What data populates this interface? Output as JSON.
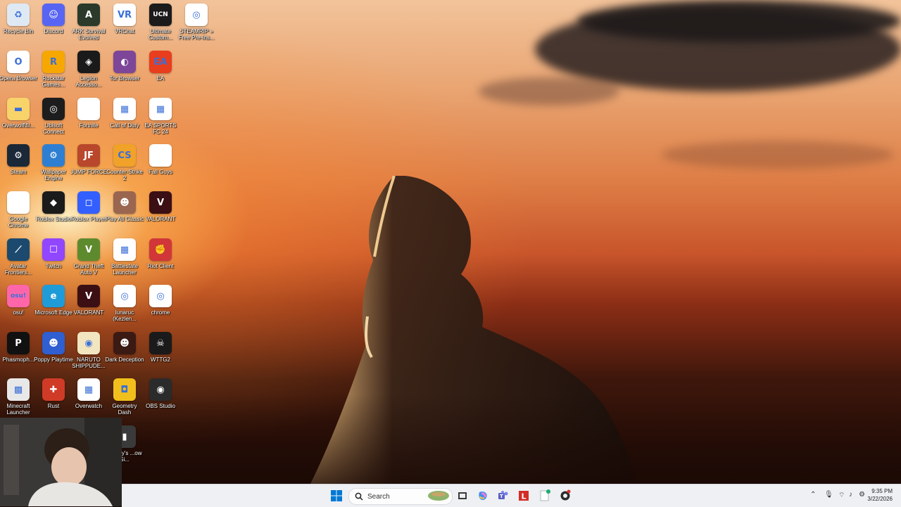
{
  "desktop": {
    "icons": [
      {
        "label": "Recycle Bin",
        "icon": "recycle-bin-icon",
        "color": "#dfe9f3",
        "glyph": "♻"
      },
      {
        "label": "Discord",
        "icon": "discord-icon",
        "color": "#5865f2",
        "glyph": "☺"
      },
      {
        "label": "ARK Survival Evolved",
        "icon": "ark-icon",
        "color": "#2b3a2a",
        "glyph": "A"
      },
      {
        "label": "VRChat",
        "icon": "vrchat-icon",
        "color": "#ffffff",
        "glyph": "VR"
      },
      {
        "label": "Ultimate Custom...",
        "icon": "ucn-icon",
        "color": "#1b1b1b",
        "glyph": "UCN"
      },
      {
        "label": "STEAMRIP » Free Pre-Ins...",
        "icon": "chrome-shortcut-icon",
        "color": "#ffffff",
        "glyph": "◎"
      },
      {
        "label": "Opera Browser",
        "icon": "opera-icon",
        "color": "#ffffff",
        "glyph": "O"
      },
      {
        "label": "Rockstar Games...",
        "icon": "rockstar-icon",
        "color": "#f6a800",
        "glyph": "R"
      },
      {
        "label": "Legion Accesso...",
        "icon": "legion-icon",
        "color": "#1a1a1a",
        "glyph": "◈"
      },
      {
        "label": "Tor Browser",
        "icon": "tor-icon",
        "color": "#7d4698",
        "glyph": "◐"
      },
      {
        "label": "EA",
        "icon": "ea-icon",
        "color": "#e83e1e",
        "glyph": "EA"
      },
      {
        "label": "Overwolf\\fil...",
        "icon": "folder-icon",
        "color": "#f7d36a",
        "glyph": "▬"
      },
      {
        "label": "Ubisoft Connect",
        "icon": "ubisoft-icon",
        "color": "#1d1d1d",
        "glyph": "◎"
      },
      {
        "label": "Fortnite",
        "icon": "file-icon",
        "color": "#ffffff",
        "glyph": ""
      },
      {
        "label": "Call of Duty",
        "icon": "cod-icon",
        "color": "#ffffff",
        "glyph": "▦"
      },
      {
        "label": "EA SPORTS FC 24",
        "icon": "eafc-icon",
        "color": "#ffffff",
        "glyph": "▦"
      },
      {
        "label": "Steam",
        "icon": "steam-icon",
        "color": "#1b2838",
        "glyph": "⚙"
      },
      {
        "label": "Wallpaper Engine",
        "icon": "wallpaper-engine-icon",
        "color": "#2e7fd1",
        "glyph": "⚙"
      },
      {
        "label": "JUMP FORCE",
        "icon": "jump-force-icon",
        "color": "#b9472b",
        "glyph": "JF"
      },
      {
        "label": "Counter-Strike 2",
        "icon": "cs2-icon",
        "color": "#f0a229",
        "glyph": "CS"
      },
      {
        "label": "Fall Guys",
        "icon": "file-icon",
        "color": "#ffffff",
        "glyph": ""
      },
      {
        "label": "Google Chrome",
        "icon": "file-icon",
        "color": "#ffffff",
        "glyph": ""
      },
      {
        "label": "Roblox Studio",
        "icon": "roblox-studio-icon",
        "color": "#1b1b1b",
        "glyph": "◆"
      },
      {
        "label": "Roblox Player",
        "icon": "roblox-icon",
        "color": "#335fff",
        "glyph": "◻"
      },
      {
        "label": "Play All Classic",
        "icon": "play-all-icon",
        "color": "#9a6650",
        "glyph": "☻"
      },
      {
        "label": "VALORANT",
        "icon": "valorant-icon",
        "color": "#3b0f14",
        "glyph": "V"
      },
      {
        "label": "Avatar Frontiers...",
        "icon": "avatar-icon",
        "color": "#1c4a6e",
        "glyph": "⟋"
      },
      {
        "label": "Twitch",
        "icon": "twitch-icon",
        "color": "#9146ff",
        "glyph": "☐"
      },
      {
        "label": "Grand Theft Auto V",
        "icon": "gta-icon",
        "color": "#5e8a2e",
        "glyph": "V"
      },
      {
        "label": "Battlestate Launcher",
        "icon": "battlestate-icon",
        "color": "#ffffff",
        "glyph": "▦"
      },
      {
        "label": "Riot Client",
        "icon": "riot-icon",
        "color": "#d13639",
        "glyph": "✊"
      },
      {
        "label": "osu!",
        "icon": "osu-icon",
        "color": "#ff66aa",
        "glyph": "osu!"
      },
      {
        "label": "Microsoft Edge",
        "icon": "edge-icon",
        "color": "#1f9cd8",
        "glyph": "e"
      },
      {
        "label": "VALORANT",
        "icon": "valorant-icon",
        "color": "#3b0f14",
        "glyph": "V"
      },
      {
        "label": "lunaruc (Kezlen...",
        "icon": "chrome-icon",
        "color": "#ffffff",
        "glyph": "◎"
      },
      {
        "label": "chrome",
        "icon": "chrome-icon",
        "color": "#ffffff",
        "glyph": "◎"
      },
      {
        "label": "Phasmoph...",
        "icon": "phasmophobia-icon",
        "color": "#111111",
        "glyph": "P"
      },
      {
        "label": "Poppy Playtime",
        "icon": "poppy-icon",
        "color": "#2f5fd0",
        "glyph": "☻"
      },
      {
        "label": "NARUTO SHIPPUDE...",
        "icon": "naruto-icon",
        "color": "#f2e6c0",
        "glyph": "◉"
      },
      {
        "label": "Dark Deception",
        "icon": "dark-deception-icon",
        "color": "#3b1a14",
        "glyph": "☻"
      },
      {
        "label": "WTTG2",
        "icon": "wttg2-icon",
        "color": "#1a1a1a",
        "glyph": "☠"
      },
      {
        "label": "Minecraft Launcher",
        "icon": "minecraft-icon",
        "color": "#e8e8e8",
        "glyph": "▩"
      },
      {
        "label": "Rust",
        "icon": "rust-icon",
        "color": "#cf3b26",
        "glyph": "✚"
      },
      {
        "label": "Overwatch",
        "icon": "overwatch-icon",
        "color": "#ffffff",
        "glyph": "▦"
      },
      {
        "label": "Geometry Dash",
        "icon": "geometry-dash-icon",
        "color": "#f2c01c",
        "glyph": "◘"
      },
      {
        "label": "OBS Studio",
        "icon": "obs-icon",
        "color": "#2b2b2b",
        "glyph": "◉"
      },
      {
        "label": "Clancy's ...ow Si...",
        "icon": "clancy-icon",
        "color": "#3a3a3a",
        "glyph": "▮"
      }
    ]
  },
  "taskbar": {
    "search_placeholder": "Search",
    "time": "9:35 PM",
    "date": "3/22/2026",
    "start_icon": "windows-start-icon",
    "pinned": [
      "task-view-icon",
      "copilot-icon",
      "teams-icon",
      "lastpass-icon",
      "notepad-icon",
      "obs-taskbar-icon"
    ]
  }
}
